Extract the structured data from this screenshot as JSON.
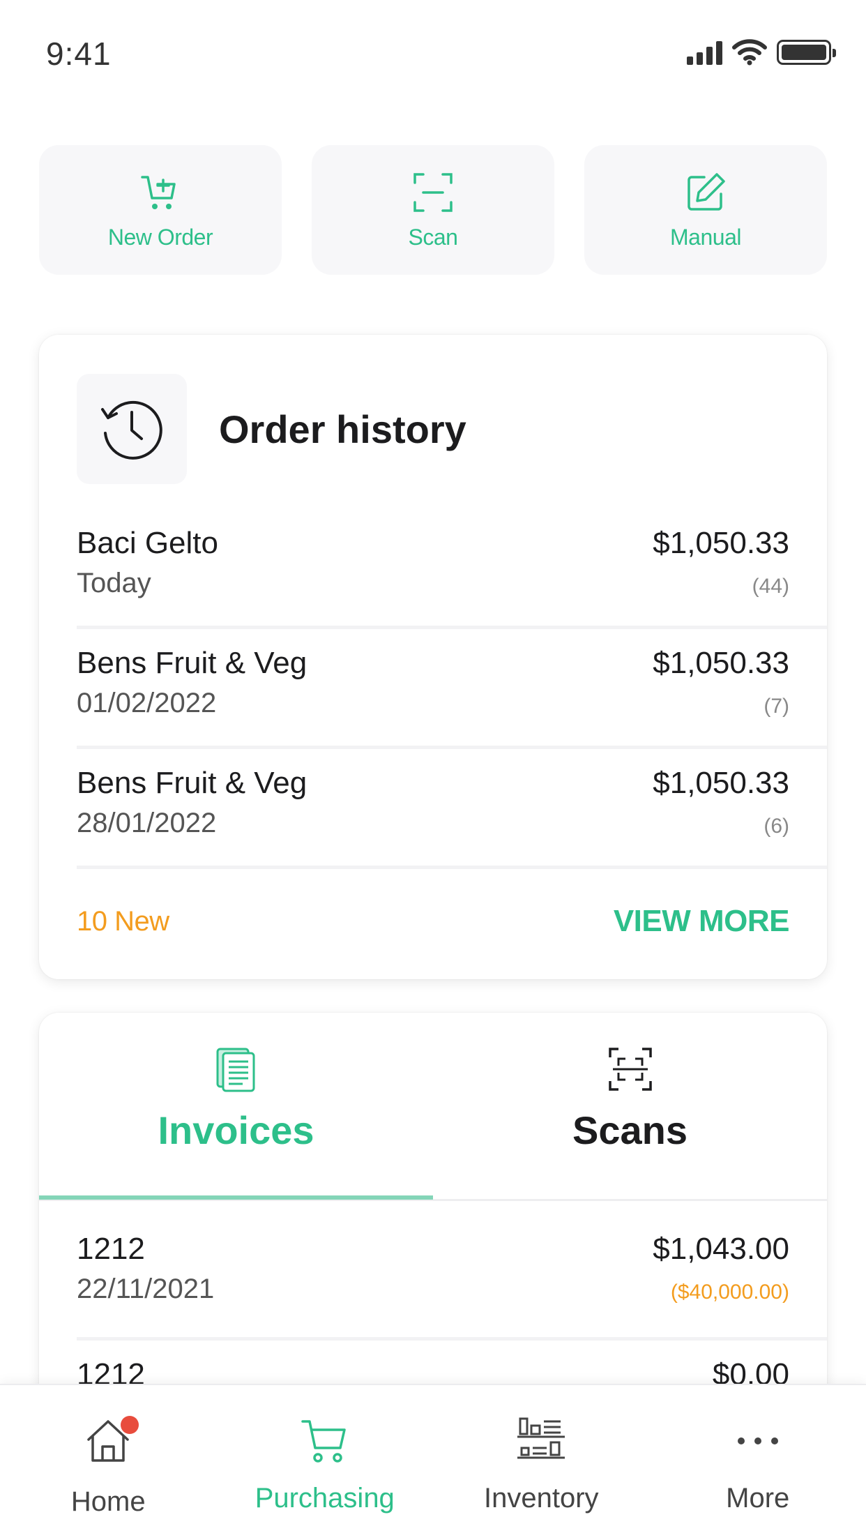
{
  "status_bar": {
    "time": "9:41"
  },
  "quick_actions": [
    {
      "label": "New Order",
      "icon": "cart-add-icon"
    },
    {
      "label": "Scan",
      "icon": "scan-icon"
    },
    {
      "label": "Manual",
      "icon": "edit-icon"
    }
  ],
  "order_history": {
    "title": "Order history",
    "icon": "history-clock-icon",
    "rows": [
      {
        "name": "Baci Gelto",
        "date": "Today",
        "amount": "$1,050.33",
        "count": "(44)"
      },
      {
        "name": "Bens Fruit & Veg",
        "date": "01/02/2022",
        "amount": "$1,050.33",
        "count": "(7)"
      },
      {
        "name": "Bens Fruit & Veg",
        "date": "28/01/2022",
        "amount": "$1,050.33",
        "count": "(6)"
      }
    ],
    "new_count": "10 New",
    "view_more": "VIEW MORE"
  },
  "documents": {
    "tabs": [
      {
        "label": "Invoices",
        "icon": "invoice-icon"
      },
      {
        "label": "Scans",
        "icon": "scan-frame-icon"
      }
    ],
    "rows": [
      {
        "number": "1212",
        "date": "22/11/2021",
        "amount": "$1,043.00",
        "sub_amount": "($40,000.00)"
      },
      {
        "number": "1212",
        "date": "",
        "amount": "$0.00",
        "sub_amount": ""
      }
    ]
  },
  "bottom_nav": [
    {
      "label": "Home",
      "icon": "home-icon"
    },
    {
      "label": "Purchasing",
      "icon": "cart-icon"
    },
    {
      "label": "Inventory",
      "icon": "inventory-icon"
    },
    {
      "label": "More",
      "icon": "more-icon"
    }
  ],
  "colors": {
    "accent": "#2dbf8a",
    "warning": "#f39c1e",
    "badge": "#e84c3d"
  }
}
